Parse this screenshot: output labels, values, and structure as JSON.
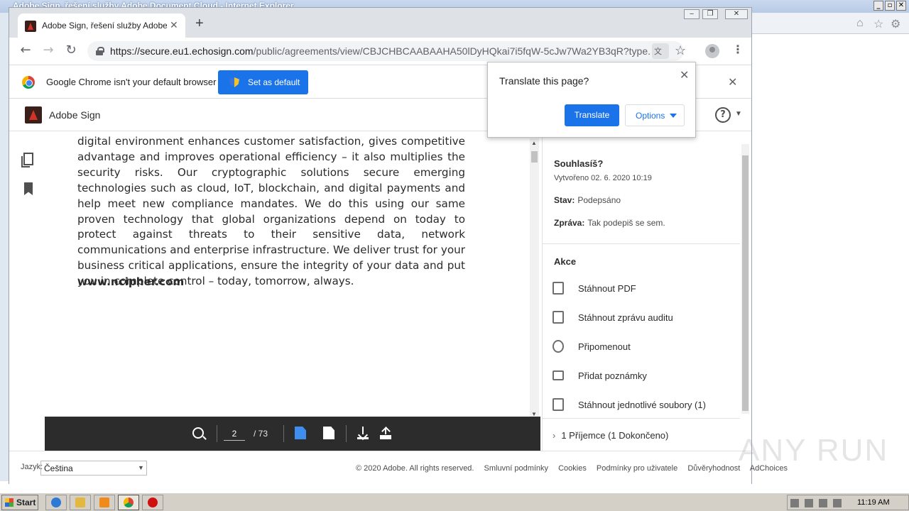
{
  "ie": {
    "title": "Adobe Sign, řešení služby Adobe Document Cloud - Internet Explorer"
  },
  "tab": {
    "title": "Adobe Sign, řešení služby Adobe Do",
    "close": "✕",
    "new_tab": "+"
  },
  "toolbar": {
    "back": "←",
    "forward": "→",
    "reload": "↻",
    "url_host": "https://secure.eu1.echosign.com",
    "url_path": "/public/agreements/view/CBJCHBCAABAAHA50lDyHQkai7i5fqW-5cJw7Wa2YB3qR?type...",
    "star": "☆",
    "menu": "⋮"
  },
  "infobar": {
    "text": "Google Chrome isn't your default browser",
    "set_default": "Set as default",
    "close": "✕"
  },
  "sign": {
    "title": "Adobe Sign",
    "help": "?"
  },
  "document": {
    "paragraph": "digital environment enhances customer satisfaction, gives competitive advantage and improves operational efficiency – it also multiplies the security risks. Our cryptographic solutions secure emerging technologies such as cloud, IoT, blockchain, and digital payments and help meet new compliance mandates. We do this using our same proven technology that global organizations depend on today to protect against threats to their sensitive data, network communications and enterprise infrastructure. We deliver trust for your business critical applications, ensure the integrity of your data and put you in complete control – today, tomorrow, always.",
    "website": "www.ncipher.com"
  },
  "doc_toolbar": {
    "page": "2",
    "total": "/ 73"
  },
  "panel": {
    "title": "Souhlasíš?",
    "created": "Vytvořeno 02. 6. 2020 10:19",
    "status_label": "Stav:",
    "status_value": "Podepsáno",
    "message_label": "Zpráva:",
    "message_value": "Tak podepiš se sem.",
    "actions_heading": "Akce",
    "actions": [
      {
        "label": "Stáhnout PDF",
        "icon": "pdf-download-icon"
      },
      {
        "label": "Stáhnout zprávu auditu",
        "icon": "audit-report-icon"
      },
      {
        "label": "Připomenout",
        "icon": "alarm-clock-icon"
      },
      {
        "label": "Přidat poznámky",
        "icon": "comment-icon"
      },
      {
        "label": "Stáhnout jednotlivé soubory (1)",
        "icon": "file-download-icon"
      }
    ],
    "recipients": "1 Příjemce (1 Dokončeno)"
  },
  "translate": {
    "title": "Translate this page?",
    "translate_btn": "Translate",
    "options_btn": "Options",
    "close": "✕"
  },
  "footer": {
    "lang_label": "Jazyk:",
    "lang_value": "Čeština",
    "copyright": "© 2020 Adobe. All rights reserved.",
    "links": [
      "Smluvní podmínky",
      "Cookies",
      "Podmínky pro uživatele",
      "Důvěryhodnost",
      "AdChoices"
    ]
  },
  "taskbar": {
    "start": "Start",
    "clock": "11:19 AM"
  },
  "watermark": "ANY RUN"
}
